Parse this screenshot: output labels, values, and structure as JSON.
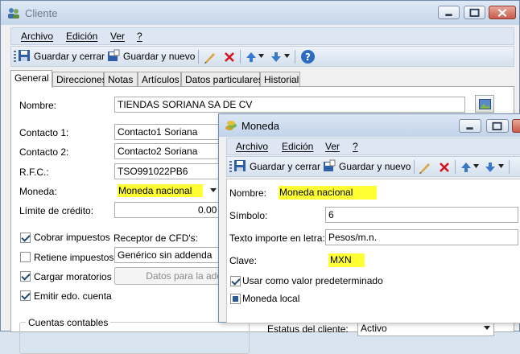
{
  "main": {
    "title": "Cliente",
    "menu": [
      "Archivo",
      "Edición",
      "Ver",
      "?"
    ],
    "toolbar": {
      "save_close": "Guardar y cerrar",
      "save_new": "Guardar y nuevo"
    },
    "tabs": [
      "General",
      "Direcciones",
      "Notas",
      "Artículos",
      "Datos particulares",
      "Historial"
    ],
    "form": {
      "nombre_label": "Nombre:",
      "nombre_value": "TIENDAS SORIANA SA DE CV",
      "contacto1_label": "Contacto 1:",
      "contacto1_value": "Contacto1 Soriana",
      "contacto2_label": "Contacto 2:",
      "contacto2_value": "Contacto2 Soriana",
      "rfc_label": "R.F.C.:",
      "rfc_value": "TSO991022PB6",
      "moneda_label": "Moneda:",
      "moneda_value": "Moneda nacional",
      "limite_label": "Límite de crédito:",
      "limite_value": "0.00",
      "cobrar_impuestos": "Cobrar impuestos",
      "retiene_impuestos": "Retiene impuestos",
      "cargar_moratorios": "Cargar moratorios",
      "emitir_edo_cuenta": "Emitir edo. cuenta",
      "receptor_label": "Receptor de CFD's:",
      "receptor_value": "Genérico sin addenda",
      "datos_addenda_button": "Datos para la addenda",
      "cuentas_contables": "Cuentas contables",
      "estatus_label": "Estatus del cliente:",
      "estatus_value": "Activo"
    }
  },
  "moneda": {
    "title": "Moneda",
    "menu": [
      "Archivo",
      "Edición",
      "Ver",
      "?"
    ],
    "toolbar": {
      "save_close": "Guardar y cerrar",
      "save_new": "Guardar y nuevo"
    },
    "form": {
      "nombre_label": "Nombre:",
      "nombre_value": "Moneda nacional",
      "simbolo_label": "Símbolo:",
      "simbolo_value": "6",
      "texto_label": "Texto importe en letra:",
      "texto_value": "Pesos/m.n.",
      "clave_label": "Clave:",
      "clave_value": "MXN",
      "predeterminado": "Usar como valor predeterminado",
      "moneda_local": "Moneda local"
    }
  },
  "colors": {
    "highlight": "#ffff33",
    "titlebar": "#c5d6ea",
    "accent": "#2a5d95"
  }
}
